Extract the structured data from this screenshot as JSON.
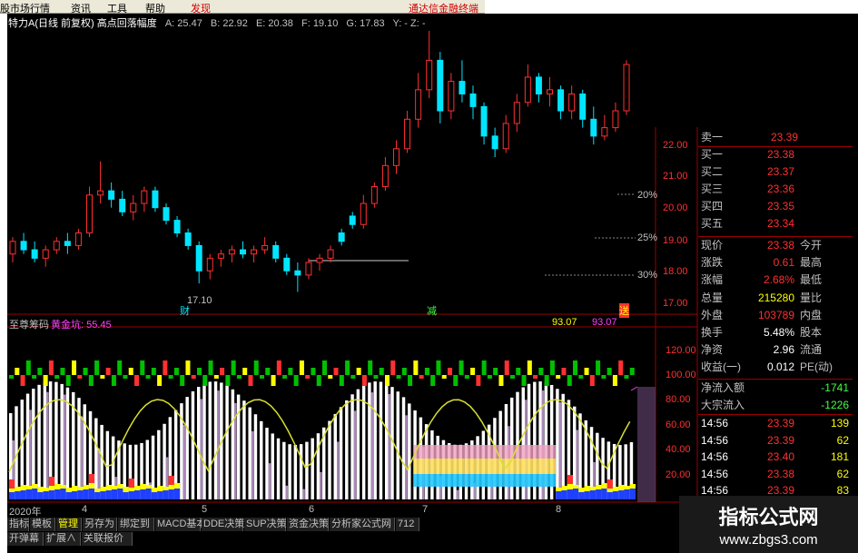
{
  "menu": {
    "items": [
      "股市场行情",
      "资讯",
      "工具",
      "帮助",
      "发现",
      "通达信金融终端"
    ]
  },
  "header": {
    "title": "特力A(日线 前复权) 高点回落幅度",
    "A": "A: 25.47",
    "B": "B: 22.92",
    "E": "E: 20.38",
    "F": "F: 19.10",
    "G": "G: 17.83",
    "tail": "Y: -  Z: -"
  },
  "price_axis": {
    "labels": [
      "22.00",
      "21.00",
      "20.00",
      "19.00",
      "18.00",
      "17.00"
    ]
  },
  "pct_labels": [
    "20%",
    "25%",
    "30%"
  ],
  "annotations": {
    "low": "17.10",
    "marker1": "财",
    "marker2": "减",
    "marker3": "送"
  },
  "indicator": {
    "name": "至尊筹码",
    "gold_label": "黄金坑: 55.45",
    "val1": "93.07",
    "val2": "93.07",
    "axis": [
      "120.00",
      "100.00",
      "80.00",
      "60.00",
      "40.00",
      "20.00"
    ]
  },
  "date_axis": {
    "labels": [
      "2020年",
      "4",
      "5",
      "6",
      "7",
      "8"
    ]
  },
  "quote": {
    "sell1": {
      "label": "卖一",
      "value": "23.39"
    },
    "buy": [
      {
        "label": "买一",
        "value": "23.38"
      },
      {
        "label": "买二",
        "value": "23.37"
      },
      {
        "label": "买三",
        "value": "23.36"
      },
      {
        "label": "买四",
        "value": "23.35"
      },
      {
        "label": "买五",
        "value": "23.34"
      }
    ],
    "stats": [
      {
        "label": "现价",
        "value": "23.38",
        "label2": "今开"
      },
      {
        "label": "涨跌",
        "value": "0.61",
        "label2": "最高"
      },
      {
        "label": "涨幅",
        "value": "2.68%",
        "label2": "最低"
      },
      {
        "label": "总量",
        "value": "215280",
        "label2": "量比"
      },
      {
        "label": "外盘",
        "value": "103789",
        "label2": "内盘"
      },
      {
        "label": "换手",
        "value": "5.48%",
        "label2": "股本"
      },
      {
        "label": "净资",
        "value": "2.96",
        "label2": "流通"
      },
      {
        "label": "收益(一)",
        "value": "0.012",
        "label2": "PE(动)"
      }
    ],
    "flow": [
      {
        "label": "净流入额",
        "value": "-1741"
      },
      {
        "label": "大宗流入",
        "value": "-1226"
      }
    ],
    "ticks": [
      {
        "time": "14:56",
        "price": "23.39",
        "vol": "139"
      },
      {
        "time": "14:56",
        "price": "23.39",
        "vol": "62"
      },
      {
        "time": "14:56",
        "price": "23.40",
        "vol": "181"
      },
      {
        "time": "14:56",
        "price": "23.38",
        "vol": "62"
      },
      {
        "time": "14:56",
        "price": "23.39",
        "vol": "83"
      }
    ]
  },
  "tabs": [
    "指标",
    "模板",
    "管理",
    "另存为",
    "绑定到",
    "MACD基本",
    "DDE决策",
    "SUP决策",
    "资金决策",
    "分析家公式网",
    "712"
  ],
  "tabs2": [
    "开弹幕",
    "扩展∧",
    "关联报价"
  ],
  "watermark": {
    "line1": "指标公式网",
    "line2": "www.zbgs3.com"
  },
  "colors": {
    "up": "#ff3030",
    "down": "#00e5ff",
    "label": "#c0c0c0",
    "yellow": "#ffff00",
    "magenta": "#ff40ff"
  },
  "chart_data": {
    "type": "candlestick",
    "title": "特力A(日线 前复权) 高点回落幅度",
    "y_axis_range": [
      16.7,
      23.6
    ],
    "x_axis_labels": [
      "4",
      "5",
      "6",
      "7",
      "8"
    ],
    "candles": [
      [
        18.0,
        18.4,
        17.8,
        18.3
      ],
      [
        18.3,
        18.5,
        18.0,
        18.1
      ],
      [
        18.1,
        18.3,
        17.8,
        17.9
      ],
      [
        17.9,
        18.2,
        17.7,
        18.1
      ],
      [
        18.1,
        18.4,
        18.0,
        18.3
      ],
      [
        18.3,
        18.5,
        18.0,
        18.2
      ],
      [
        18.2,
        18.6,
        18.1,
        18.5
      ],
      [
        18.5,
        19.6,
        18.4,
        19.4
      ],
      [
        19.4,
        20.2,
        19.2,
        19.5
      ],
      [
        19.5,
        19.7,
        19.1,
        19.3
      ],
      [
        19.3,
        19.5,
        18.9,
        19.0
      ],
      [
        19.0,
        19.4,
        18.8,
        19.2
      ],
      [
        19.2,
        19.6,
        19.0,
        19.5
      ],
      [
        19.5,
        19.6,
        19.0,
        19.1
      ],
      [
        19.1,
        19.2,
        18.7,
        18.8
      ],
      [
        18.8,
        18.9,
        18.4,
        18.5
      ],
      [
        18.5,
        18.6,
        18.1,
        18.2
      ],
      [
        18.2,
        18.3,
        17.3,
        17.6
      ],
      [
        17.6,
        18.0,
        17.4,
        17.9
      ],
      [
        17.9,
        18.1,
        17.7,
        18.0
      ],
      [
        18.0,
        18.2,
        17.8,
        18.1
      ],
      [
        18.1,
        18.3,
        17.9,
        18.0
      ],
      [
        18.0,
        18.2,
        17.8,
        18.1
      ],
      [
        18.1,
        18.4,
        18.0,
        18.2
      ],
      [
        18.2,
        18.3,
        17.8,
        17.9
      ],
      [
        17.9,
        18.0,
        17.5,
        17.6
      ],
      [
        17.6,
        17.8,
        17.1,
        17.5
      ],
      [
        17.5,
        17.9,
        17.4,
        17.8
      ],
      [
        17.8,
        18.0,
        17.6,
        17.9
      ],
      [
        17.9,
        18.2,
        17.8,
        18.1
      ],
      [
        18.5,
        18.6,
        18.2,
        18.3
      ],
      [
        18.9,
        19.0,
        18.6,
        18.7
      ],
      [
        18.7,
        19.4,
        18.6,
        19.2
      ],
      [
        19.2,
        19.7,
        19.1,
        19.6
      ],
      [
        19.6,
        20.3,
        19.5,
        20.1
      ],
      [
        20.1,
        20.7,
        19.9,
        20.5
      ],
      [
        20.5,
        21.4,
        20.4,
        21.2
      ],
      [
        21.2,
        22.3,
        21.0,
        21.9
      ],
      [
        21.9,
        23.3,
        21.7,
        22.6
      ],
      [
        22.6,
        22.8,
        21.1,
        21.4
      ],
      [
        21.4,
        22.3,
        21.2,
        22.1
      ],
      [
        22.1,
        22.6,
        21.6,
        21.8
      ],
      [
        21.8,
        22.0,
        21.2,
        21.5
      ],
      [
        21.5,
        21.6,
        20.6,
        20.8
      ],
      [
        20.8,
        21.0,
        20.3,
        20.5
      ],
      [
        20.5,
        21.3,
        20.4,
        21.1
      ],
      [
        21.1,
        21.8,
        20.9,
        21.6
      ],
      [
        21.6,
        22.5,
        21.5,
        22.2
      ],
      [
        22.2,
        22.3,
        21.6,
        21.8
      ],
      [
        21.8,
        22.2,
        21.5,
        21.9
      ],
      [
        21.9,
        22.0,
        21.2,
        21.4
      ],
      [
        21.4,
        22.0,
        21.2,
        21.8
      ],
      [
        21.8,
        21.9,
        21.0,
        21.2
      ],
      [
        21.2,
        21.5,
        20.6,
        20.8
      ],
      [
        20.8,
        21.3,
        20.7,
        21.0
      ],
      [
        21.0,
        21.6,
        20.9,
        21.4
      ],
      [
        21.4,
        22.6,
        21.3,
        22.5
      ]
    ]
  }
}
